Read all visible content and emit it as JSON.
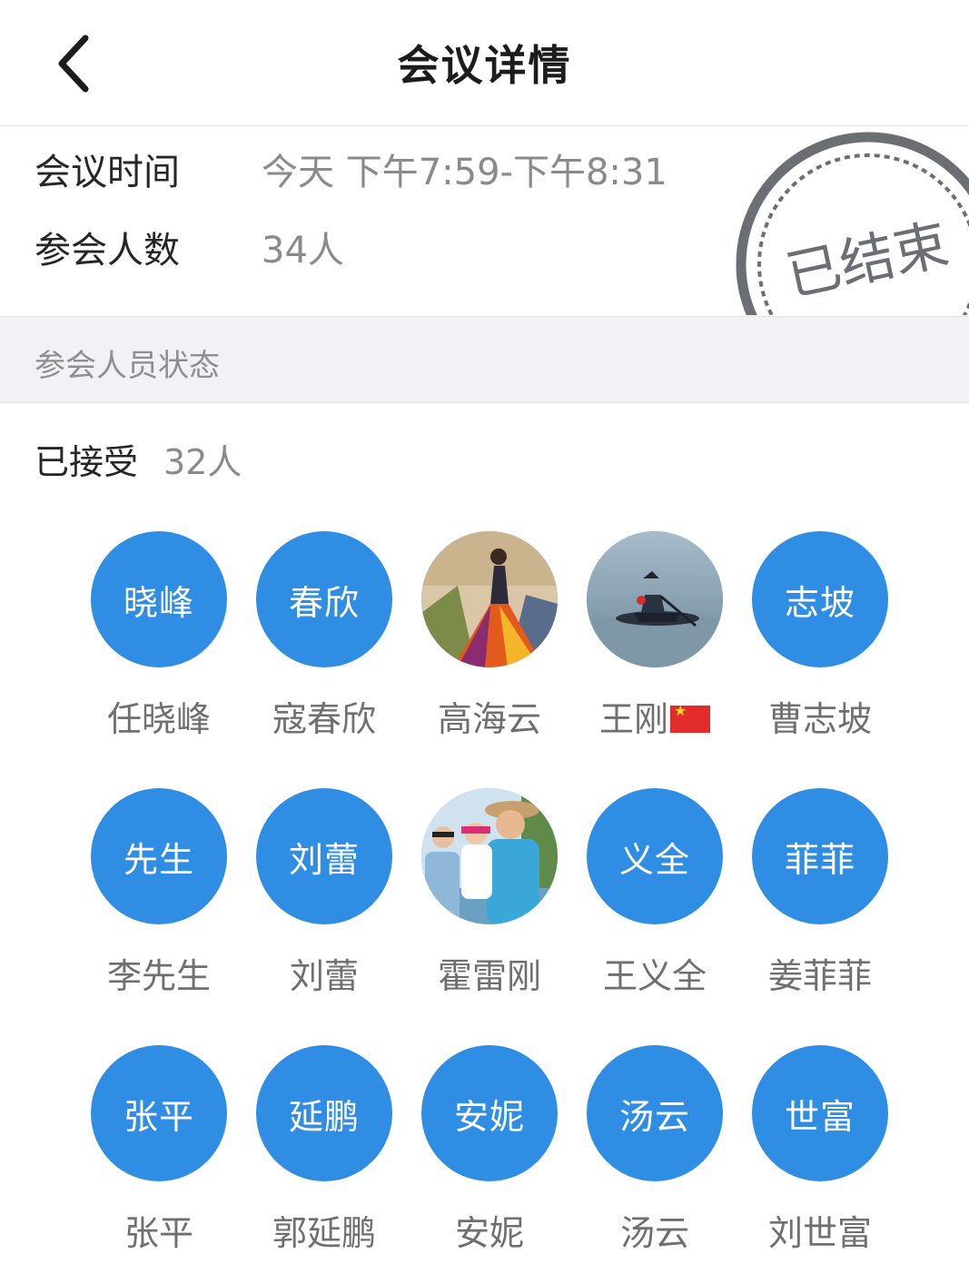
{
  "header": {
    "title": "会议详情",
    "back_icon": "chevron-left-icon"
  },
  "meeting": {
    "time_label": "会议时间",
    "time_value": "今天 下午7:59-下午8:31",
    "count_label": "参会人数",
    "count_value": "34人",
    "stamp_text": "已结束"
  },
  "section": {
    "title": "参会人员状态"
  },
  "accepted": {
    "label": "已接受",
    "count": "32人"
  },
  "colors": {
    "avatar_blue": "#2f8de4",
    "stamp_gray": "#6b6f73",
    "section_bg": "#f1f2f5"
  },
  "members": [
    {
      "avatar_text": "晓峰",
      "name": "任晓峰"
    },
    {
      "avatar_text": "春欣",
      "name": "寇春欣"
    },
    {
      "avatar_text": "",
      "name": "高海云",
      "photo": "painting-photo"
    },
    {
      "avatar_text": "",
      "name": "王刚",
      "photo": "boat-photo",
      "name_icon": "china-flag-icon"
    },
    {
      "avatar_text": "志坡",
      "name": "曹志坡"
    },
    {
      "avatar_text": "先生",
      "name": "李先生"
    },
    {
      "avatar_text": "刘蕾",
      "name": "刘蕾"
    },
    {
      "avatar_text": "",
      "name": "霍雷刚",
      "photo": "family-photo"
    },
    {
      "avatar_text": "义全",
      "name": "王义全"
    },
    {
      "avatar_text": "菲菲",
      "name": "姜菲菲"
    },
    {
      "avatar_text": "张平",
      "name": "张平"
    },
    {
      "avatar_text": "延鹏",
      "name": "郭延鹏"
    },
    {
      "avatar_text": "安妮",
      "name": "安妮"
    },
    {
      "avatar_text": "汤云",
      "name": "汤云"
    },
    {
      "avatar_text": "世富",
      "name": "刘世富"
    }
  ]
}
